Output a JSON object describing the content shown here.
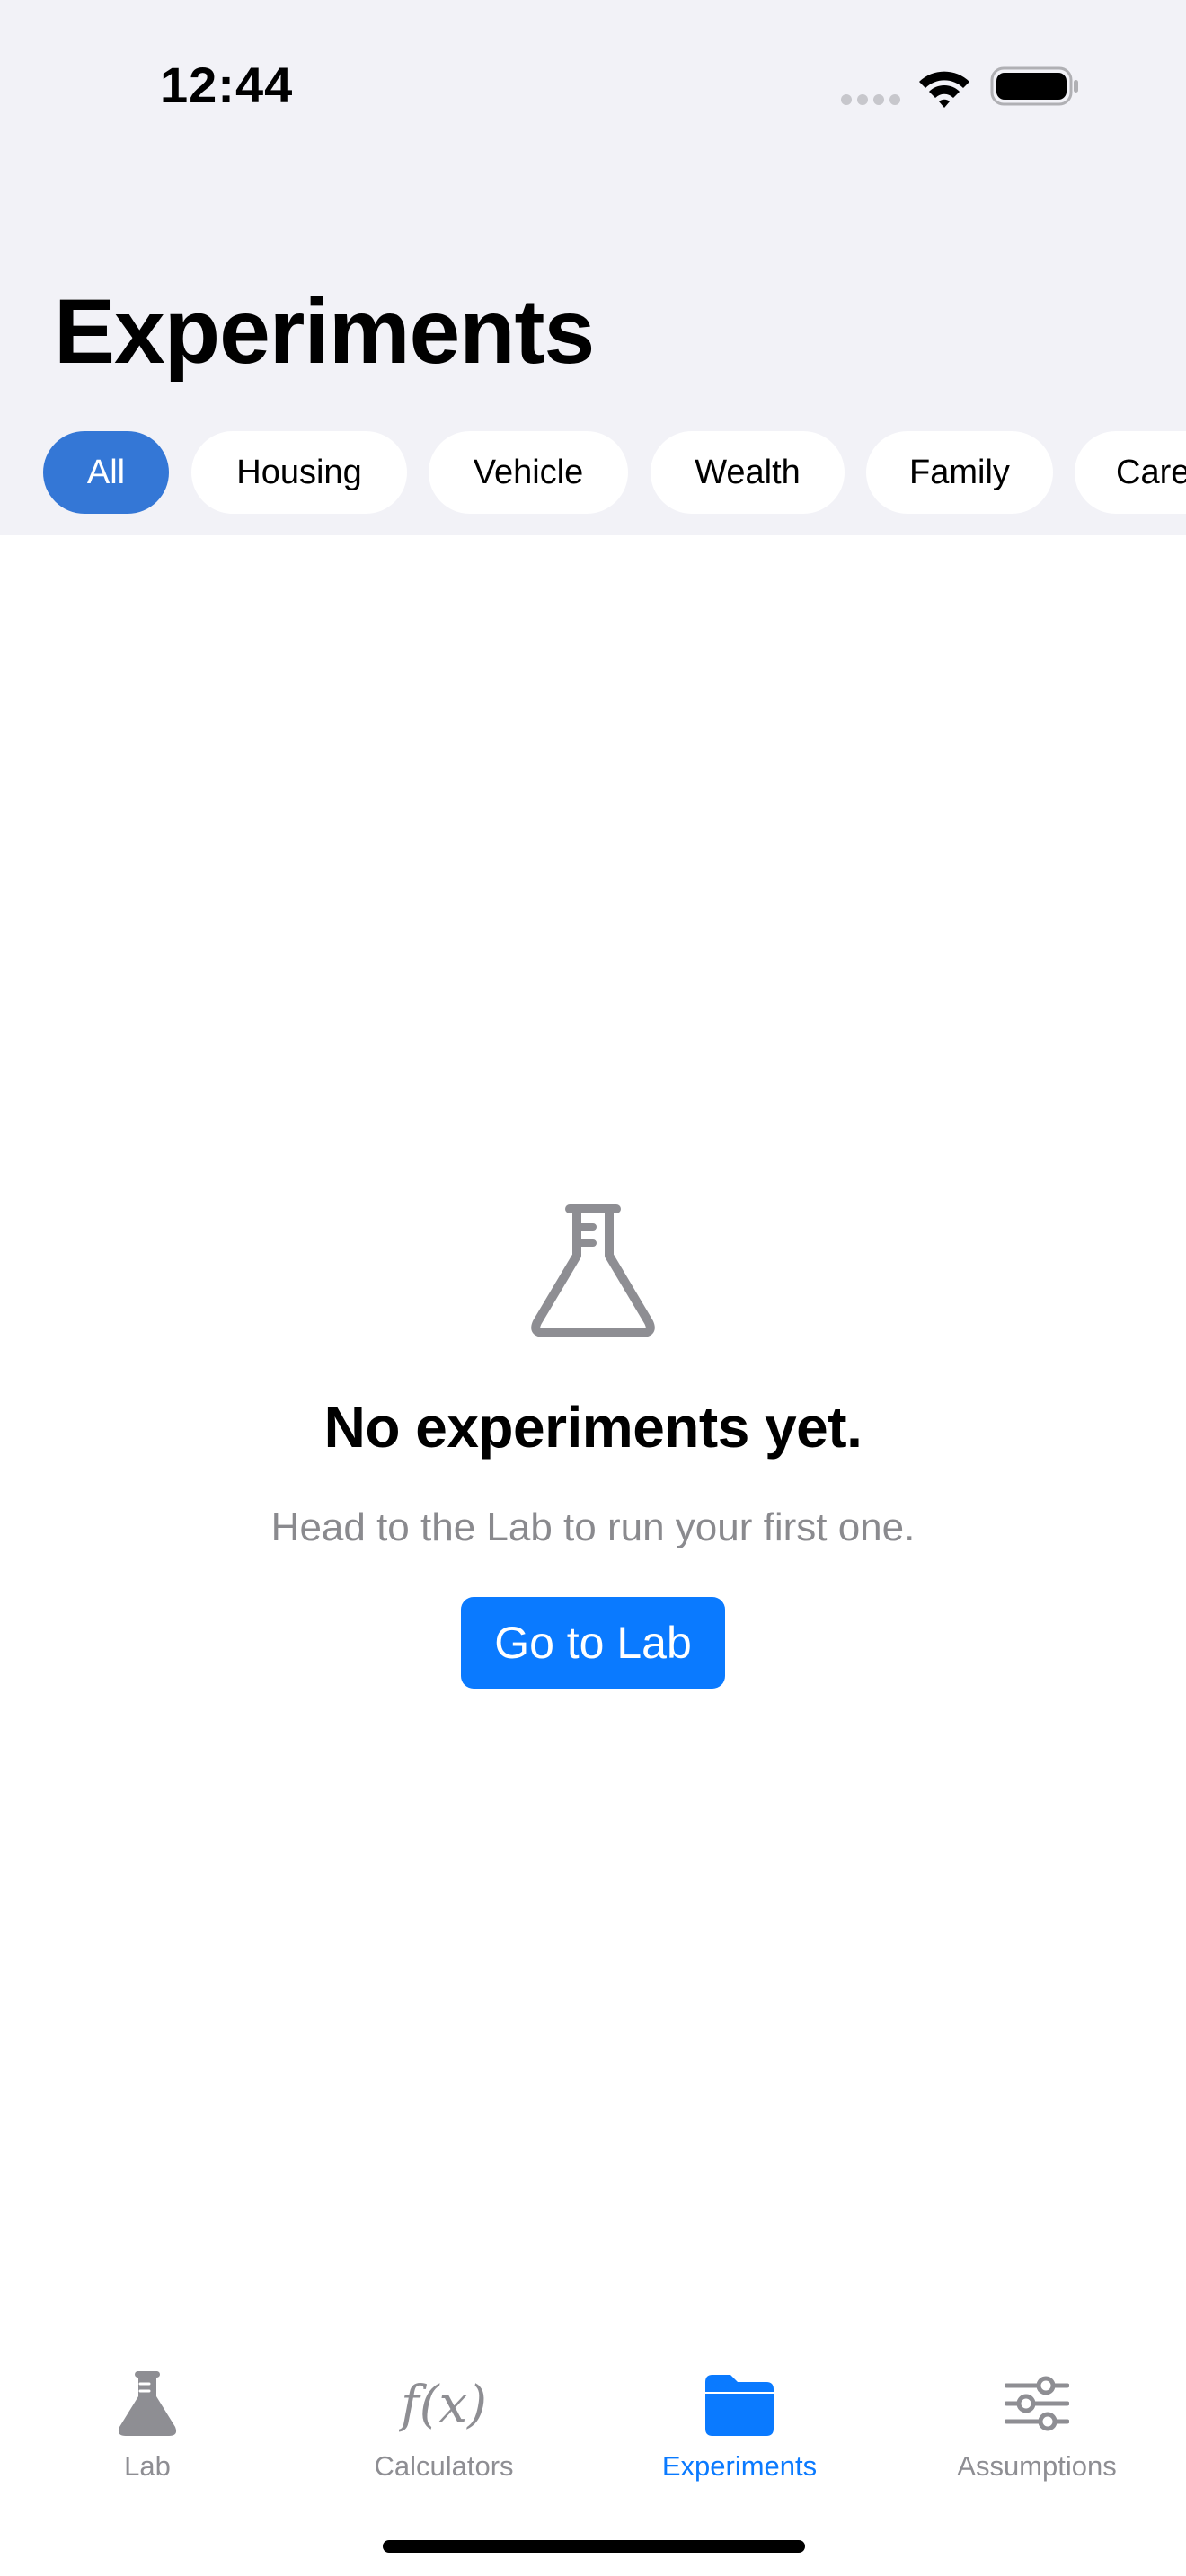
{
  "status_bar": {
    "time": "12:44"
  },
  "page": {
    "title": "Experiments"
  },
  "filters": {
    "items": [
      "All",
      "Housing",
      "Vehicle",
      "Wealth",
      "Family",
      "Care"
    ],
    "selected": "All"
  },
  "empty_state": {
    "icon": "flask-icon",
    "title": "No experiments yet.",
    "subtitle": "Head to the Lab to run your first one.",
    "button_label": "Go to Lab"
  },
  "tab_bar": {
    "tabs": [
      {
        "label": "Lab",
        "icon": "flask-icon"
      },
      {
        "label": "Calculators",
        "icon": "function-icon"
      },
      {
        "label": "Experiments",
        "icon": "folder-icon"
      },
      {
        "label": "Assumptions",
        "icon": "sliders-icon"
      }
    ],
    "active": "Experiments"
  },
  "colors": {
    "accent": "#0a7aff",
    "chip_selected": "#3477d6",
    "header_background": "#f2f2f7",
    "secondary_text": "#8a8a8e",
    "inactive_tab": "#8e8e93"
  }
}
